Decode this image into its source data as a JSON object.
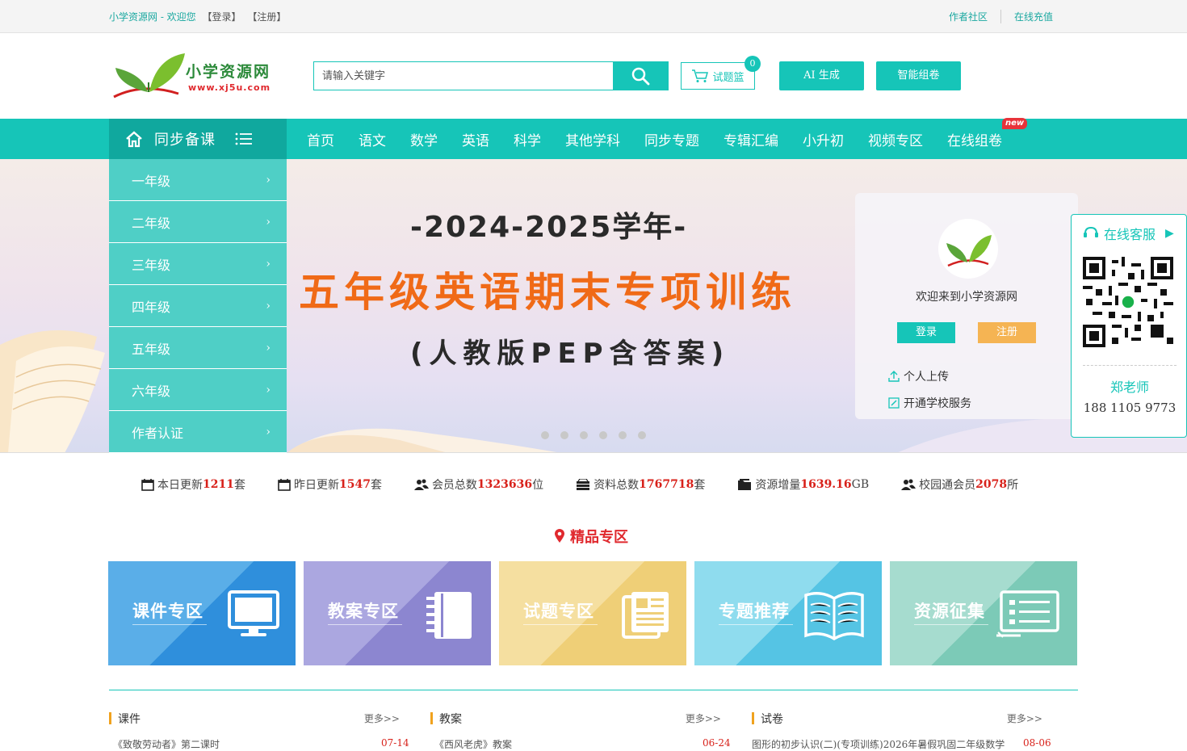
{
  "topbar": {
    "welcome": "小学资源网 - 欢迎您",
    "login": "【登录】",
    "register": "【注册】",
    "links": [
      "作者社区",
      "在线充值"
    ]
  },
  "header": {
    "logo_text": "小学资源网",
    "logo_url": "www.xj5u.com",
    "search_placeholder": "请输入关键字",
    "basket_label": "试题篮",
    "basket_count": "0",
    "ai_button": "AI 生成",
    "smart_button": "智能组卷"
  },
  "nav": {
    "category_label": "同步备课",
    "links": [
      "首页",
      "语文",
      "数学",
      "英语",
      "科学",
      "其他学科",
      "同步专题",
      "专辑汇编",
      "小升初",
      "视频专区",
      "在线组卷"
    ],
    "new_tag": "new"
  },
  "side_menu": [
    "一年级",
    "二年级",
    "三年级",
    "四年级",
    "五年级",
    "六年级",
    "作者认证"
  ],
  "banner": {
    "year": "-2024-2025学年-",
    "title": "五年级英语期末专项训练",
    "subtitle": "(人教版PEP含答案)",
    "dot_count": 6
  },
  "welcome_box": {
    "text": "欢迎来到小学资源网",
    "login": "登录",
    "register": "注册",
    "upload": "个人上传",
    "school": "开通学校服务"
  },
  "customer_service": {
    "title": "在线客服",
    "name": "郑老师",
    "phone": "188 1105 9773"
  },
  "stats": [
    {
      "label": "本日更新",
      "value": "1211",
      "unit": "套",
      "icon": "calendar-icon"
    },
    {
      "label": "昨日更新",
      "value": "1547",
      "unit": "套",
      "icon": "calendar-icon"
    },
    {
      "label": "会员总数",
      "value": "1323636",
      "unit": "位",
      "icon": "users-icon"
    },
    {
      "label": "资料总数",
      "value": "1767718",
      "unit": "套",
      "icon": "stack-icon"
    },
    {
      "label": "资源增量",
      "value": "1639.16",
      "unit": "GB",
      "icon": "folder-icon"
    },
    {
      "label": "校园通会员",
      "value": "2078",
      "unit": "所",
      "icon": "users-icon"
    }
  ],
  "section_title": "精品专区",
  "cards": [
    {
      "label": "课件专区",
      "color": "#4aa6e6",
      "icon": "monitor-icon"
    },
    {
      "label": "教案专区",
      "color": "#9a95d6",
      "icon": "notebook-icon"
    },
    {
      "label": "试题专区",
      "color": "#f0d88e",
      "icon": "document-icon"
    },
    {
      "label": "专题推荐",
      "color": "#5cc8e6",
      "icon": "book-icon"
    },
    {
      "label": "资源征集",
      "color": "#86cfc0",
      "icon": "list-icon"
    }
  ],
  "columns": [
    {
      "title": "课件",
      "more": "更多>>",
      "first_item": "《致敬劳动者》第二课时",
      "first_date": "07-14"
    },
    {
      "title": "教案",
      "more": "更多>>",
      "first_item": "《西风老虎》教案",
      "first_date": "06-24"
    },
    {
      "title": "试卷",
      "more": "更多>>",
      "first_item": "图形的初步认识(二)(专项训练)2026年暑假巩固二年级数学",
      "first_date": "08-06"
    }
  ]
}
